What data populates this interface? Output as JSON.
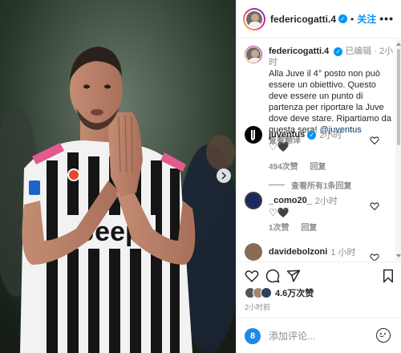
{
  "header": {
    "username": "federicogatti.4",
    "follow_label": "关注",
    "separator": "•",
    "more_label": "•••"
  },
  "caption": {
    "username": "federicogatti.4",
    "edited": "已编辑",
    "time": "2小时",
    "text": "Alla Juve il 4° posto non può essere un obiettivo. Questo deve essere un punto di partenza per riportare la Juve dove deve stare. Ripartiamo da questa sera!",
    "mention": "@juventus",
    "see_translation": "查看翻译"
  },
  "comments": [
    {
      "username": "juventus",
      "time": "2小时",
      "text": "♡🖤",
      "likes": "494次赞",
      "reply_label": "回复",
      "view_replies": "查看所有1条回复"
    },
    {
      "username": "_como20_",
      "time": "2小时",
      "text": "♡🖤",
      "likes": "1次赞",
      "reply_label": "回复"
    },
    {
      "username": "davidebolzoni",
      "time": "1 小时",
      "text": "❤"
    }
  ],
  "footer": {
    "likes_count": "4.6万次赞",
    "post_time": "2小时前",
    "comment_placeholder": "添加评论..."
  },
  "photo": {
    "jersey_sponsor": "Jeep"
  },
  "colors": {
    "accent": "#0095f6",
    "link": "#00376b",
    "muted": "#8e8e8e"
  },
  "icons": [
    "heart-icon",
    "comment-icon",
    "share-icon",
    "bookmark-icon",
    "emoji-icon",
    "more-icon",
    "verified-badge",
    "next-arrow-icon"
  ]
}
